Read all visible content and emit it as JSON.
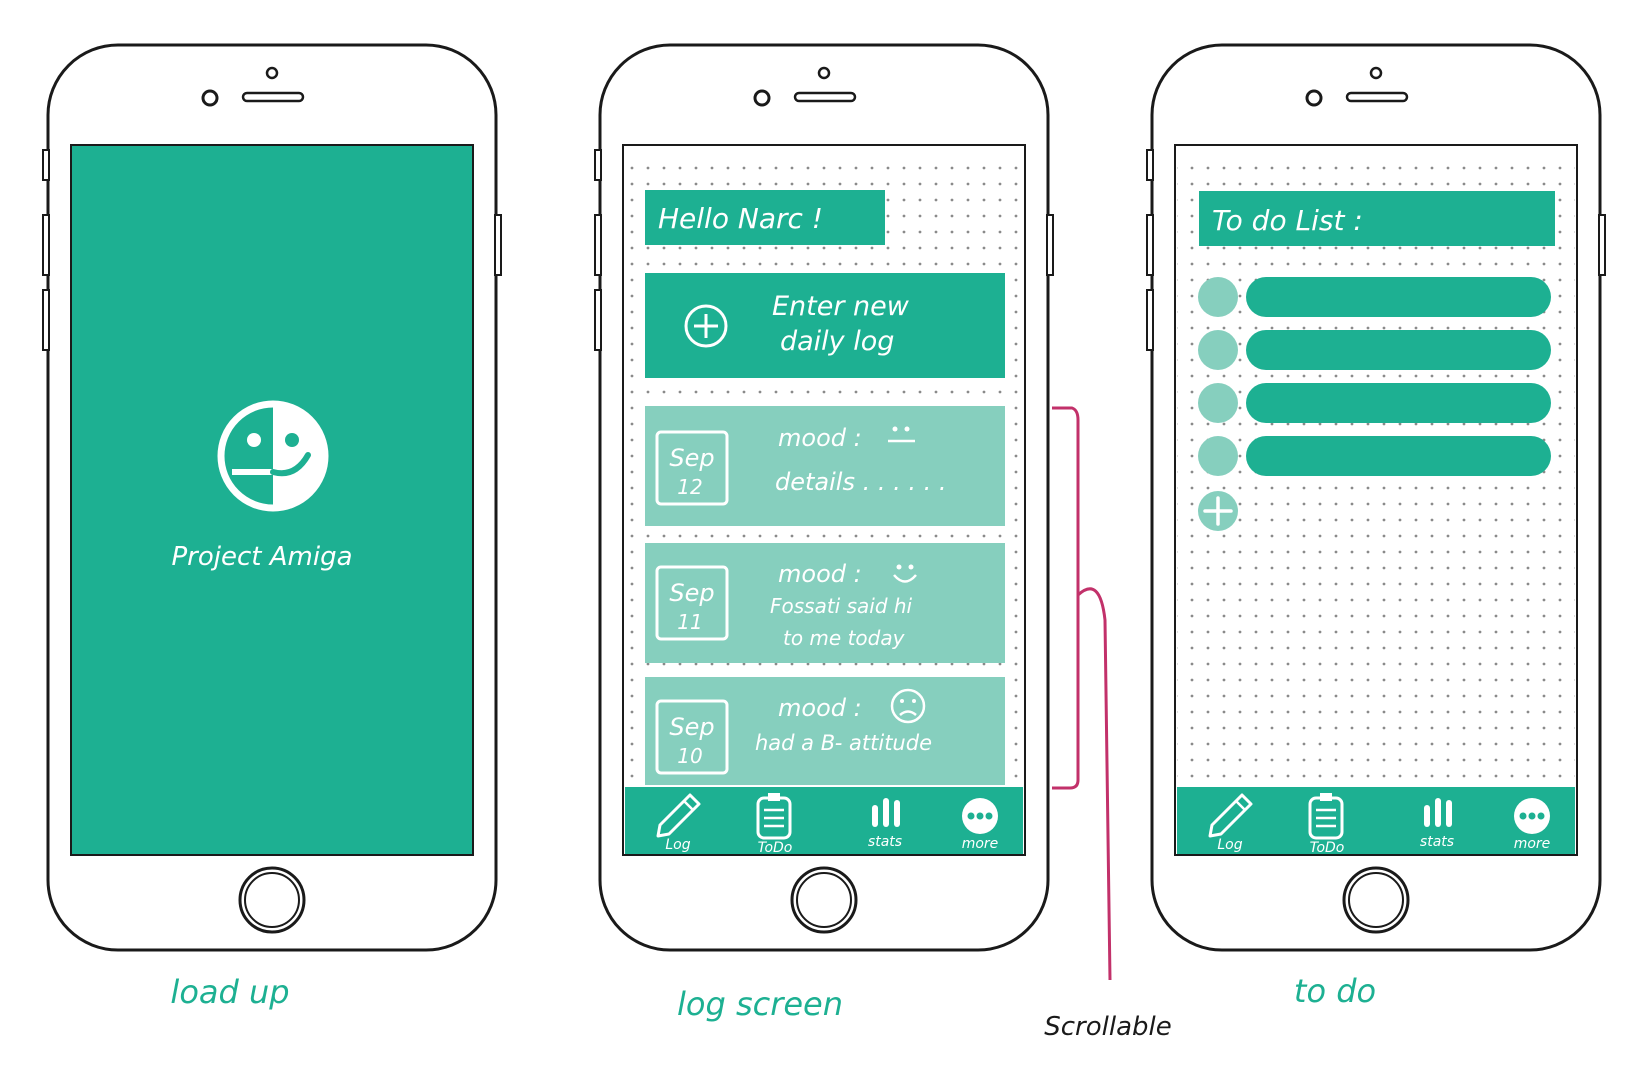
{
  "colors": {
    "primary": "#1db092",
    "light": "#86cfbe",
    "annotation": "#c2316a",
    "outline": "#1a1a1a",
    "caption": "#1db092"
  },
  "phones": [
    {
      "caption": "load up",
      "splash": {
        "logo_icon": "half-smiley-icon",
        "app_name": "Project Amiga"
      }
    },
    {
      "caption": "log screen",
      "greeting": "Hello Narc !",
      "new_log_button": {
        "icon": "plus-circle-icon",
        "line1": "Enter new",
        "line2": "daily log"
      },
      "entries": [
        {
          "month": "Sep",
          "day": "12",
          "mood_label": "mood :",
          "mood_icon": "neutral-face-icon",
          "line1": "details . . . . . .",
          "line2": ""
        },
        {
          "month": "Sep",
          "day": "11",
          "mood_label": "mood :",
          "mood_icon": "smile-face-icon",
          "line1": "Fossati said hi",
          "line2": "to me today"
        },
        {
          "month": "Sep",
          "day": "10",
          "mood_label": "mood :",
          "mood_icon": "sad-face-icon",
          "line1": "had a B- attitude",
          "line2": ""
        }
      ]
    },
    {
      "caption": "to do",
      "title": "To do List :",
      "todo_count": 4,
      "add_icon": "plus-icon"
    }
  ],
  "tabbar": [
    {
      "label": "Log",
      "icon": "pencil-icon"
    },
    {
      "label": "ToDo",
      "icon": "clipboard-icon"
    },
    {
      "label": "stats",
      "icon": "bars-icon"
    },
    {
      "label": "more",
      "icon": "dots-icon"
    }
  ],
  "annotation": {
    "label": "Scrollable"
  }
}
